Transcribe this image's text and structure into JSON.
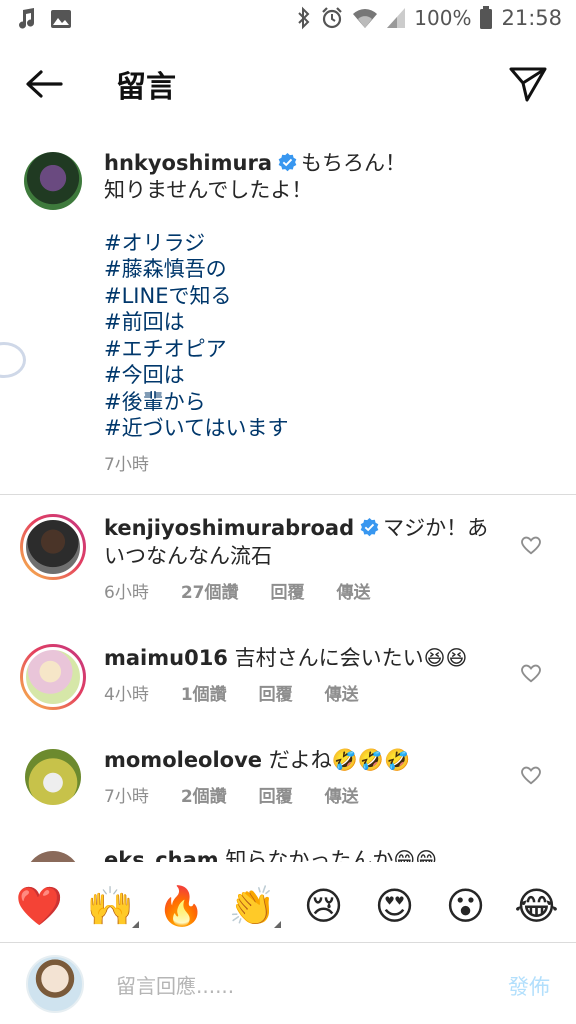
{
  "status_bar": {
    "battery": "100%",
    "time": "21:58",
    "icons": [
      "music-note-icon",
      "image-icon",
      "bluetooth-icon",
      "alarm-icon",
      "wifi-icon",
      "signal-icon",
      "battery-icon"
    ]
  },
  "header": {
    "title": "留言"
  },
  "caption": {
    "username": "hnkyoshimura",
    "text_line1": "もちろん！",
    "text_line2": "知りませんでしたよ！",
    "hashtags": [
      "#オリラジ",
      "#藤森慎吾の",
      "#LINEで知る",
      "#前回は",
      "#エチオピア",
      "#今回は",
      "#後輩から",
      "#近づいてはいます"
    ],
    "time": "7小時"
  },
  "comments": [
    {
      "username": "kenjiyoshimurabroad",
      "verified": true,
      "text": "マジか！あいつなんなん流石",
      "time": "6小時",
      "likes": "27個讚",
      "reply": "回覆",
      "send": "傳送"
    },
    {
      "username": "maimu016",
      "verified": false,
      "text": "吉村さんに会いたい😆😆",
      "time": "4小時",
      "likes": "1個讚",
      "reply": "回覆",
      "send": "傳送"
    },
    {
      "username": "momoleolove",
      "verified": false,
      "text": "だよね🤣🤣🤣",
      "time": "7小時",
      "likes": "2個讚",
      "reply": "回覆",
      "send": "傳送"
    },
    {
      "username": "eks_cham",
      "verified": false,
      "text": "知らなかったんか😁😁"
    }
  ],
  "emoji_bar": [
    "❤️",
    "🙌",
    "🔥",
    "👏",
    "😢",
    "😍",
    "😮",
    "😂"
  ],
  "reply_bar": {
    "placeholder": "留言回應......",
    "post_label": "發佈"
  },
  "colors": {
    "hashtag": "#00376b",
    "verified": "#3897f0",
    "meta": "#8e8e8e",
    "post_disabled": "#b2dffc"
  }
}
